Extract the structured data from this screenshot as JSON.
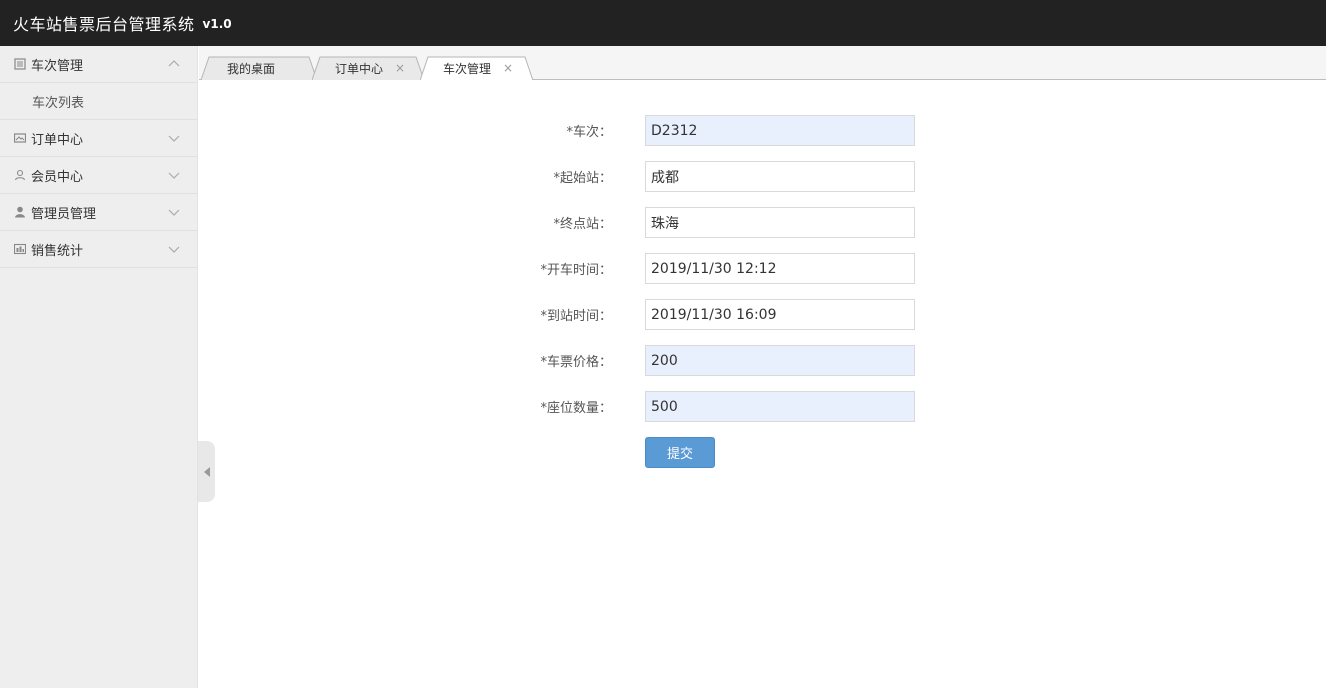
{
  "header": {
    "title": "火车站售票后台管理系统",
    "version": "v1.0"
  },
  "sidebar": {
    "items": [
      {
        "label": "车次管理",
        "icon": "list-icon",
        "expanded": true,
        "children": [
          {
            "label": "车次列表"
          }
        ]
      },
      {
        "label": "订单中心",
        "icon": "image-icon",
        "expanded": false
      },
      {
        "label": "会员中心",
        "icon": "user-outline-icon",
        "expanded": false
      },
      {
        "label": "管理员管理",
        "icon": "user-solid-icon",
        "expanded": false
      },
      {
        "label": "销售统计",
        "icon": "chart-icon",
        "expanded": false
      }
    ]
  },
  "tabs": [
    {
      "label": "我的桌面",
      "closable": false,
      "active": false
    },
    {
      "label": "订单中心",
      "closable": true,
      "active": false,
      "close": "×"
    },
    {
      "label": "车次管理",
      "closable": true,
      "active": true,
      "close": "×"
    }
  ],
  "form": {
    "fields": [
      {
        "label": "*车次：",
        "value": "D2312"
      },
      {
        "label": "*起始站：",
        "value": "成都"
      },
      {
        "label": "*终点站：",
        "value": "珠海"
      },
      {
        "label": "*开车时间：",
        "value": "2019/11/30 12:12"
      },
      {
        "label": "*到站时间：",
        "value": "2019/11/30 16:09"
      },
      {
        "label": "*车票价格：",
        "value": "200"
      },
      {
        "label": "*座位数量：",
        "value": "500"
      }
    ],
    "submit_label": "提交"
  },
  "colors": {
    "topbar": "#222222",
    "sidebar": "#eeeeee",
    "submit": "#5b9bd5",
    "autofill": "#e8f0fe"
  }
}
